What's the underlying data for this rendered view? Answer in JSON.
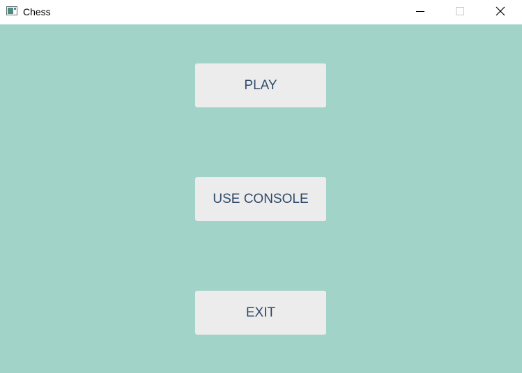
{
  "window": {
    "title": "Chess",
    "app_icon": "chess-app-icon",
    "controls": {
      "minimize_icon": "minimize-icon",
      "maximize_icon": "maximize-icon",
      "close_icon": "close-icon"
    }
  },
  "menu": {
    "play_label": "PLAY",
    "console_label": "USE CONSOLE",
    "exit_label": "EXIT"
  },
  "colors": {
    "background": "#a1d3c8",
    "button_background": "#ececec",
    "button_text": "#2f4a6a",
    "titlebar": "#ffffff"
  }
}
